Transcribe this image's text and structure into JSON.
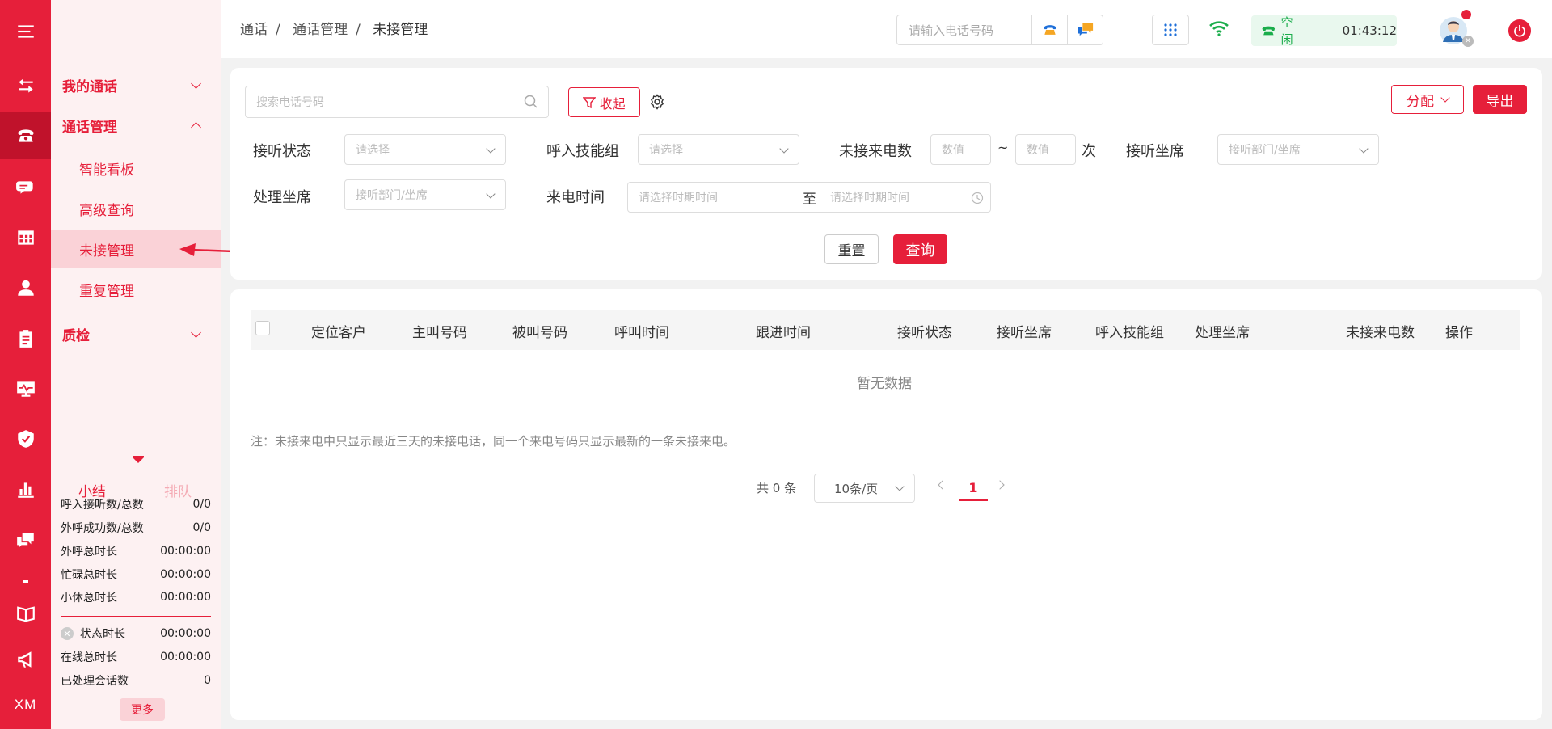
{
  "rail": {
    "xm_label": "XM"
  },
  "nav": {
    "groups": [
      {
        "label": "我的通话",
        "expanded": false
      },
      {
        "label": "通话管理",
        "expanded": true
      },
      {
        "label": "质检",
        "expanded": false
      }
    ],
    "items": [
      "智能看板",
      "高级查询",
      "未接管理",
      "重复管理"
    ],
    "selected": "未接管理"
  },
  "stats": {
    "tab_active": "小结",
    "tab_inactive": "排队",
    "rows": [
      {
        "label": "呼入接听数/总数",
        "value": "0/0"
      },
      {
        "label": "外呼成功数/总数",
        "value": "0/0"
      },
      {
        "label": "外呼总时长",
        "value": "00:00:00"
      },
      {
        "label": "忙碌总时长",
        "value": "00:00:00"
      },
      {
        "label": "小休总时长",
        "value": "00:00:00"
      }
    ],
    "rows2": [
      {
        "label": "状态时长",
        "value": "00:00:00"
      },
      {
        "label": "在线总时长",
        "value": "00:00:00"
      },
      {
        "label": "已处理会话数",
        "value": "0"
      }
    ],
    "more_label": "更多"
  },
  "header": {
    "breadcrumb": [
      "通话",
      "通话管理",
      "未接管理"
    ],
    "phone_placeholder": "请输入电话号码",
    "status_label": "空闲",
    "timer": "01:43:12"
  },
  "filters": {
    "search_placeholder": "搜索电话号码",
    "collapse_label": "收起",
    "assign_label": "分配",
    "export_label": "导出",
    "answer_status_label": "接听状态",
    "select_placeholder": "请选择",
    "skill_group_label": "呼入技能组",
    "missed_count_label": "未接来电数",
    "number_placeholder": "数值",
    "range_sep": "~",
    "times_unit": "次",
    "answer_seat_label": "接听坐席",
    "dept_seat_placeholder": "接听部门/坐席",
    "handle_seat_label": "处理坐席",
    "call_time_label": "来电时间",
    "date_placeholder": "请选择时期时间",
    "to_label": "至",
    "reset_label": "重置",
    "query_label": "查询"
  },
  "table": {
    "columns": [
      "定位客户",
      "主叫号码",
      "被叫号码",
      "呼叫时间",
      "跟进时间",
      "接听状态",
      "接听坐席",
      "呼入技能组",
      "处理坐席",
      "未接来电数",
      "操作"
    ],
    "empty_text": "暂无数据",
    "note": "注：未接来电中只显示最近三天的未接电话，同一个来电号码只显示最新的一条未接来电。"
  },
  "pagination": {
    "total": "共 0 条",
    "page_size": "10条/页",
    "current_page": "1"
  },
  "colors": {
    "brand": "#e61f3a",
    "status_green": "#1aad4b"
  }
}
